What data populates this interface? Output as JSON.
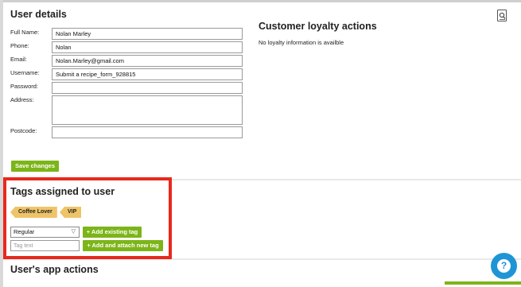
{
  "user_details": {
    "title": "User details",
    "fields": {
      "full_name": {
        "label": "Full Name:",
        "value": "Nolan Marley"
      },
      "phone": {
        "label": "Phone:",
        "value": "Nolan"
      },
      "email": {
        "label": "Email:",
        "value": "Nolan.Marley@gmail.com"
      },
      "username": {
        "label": "Username:",
        "value": "Submit a recipe_form_928815"
      },
      "password": {
        "label": "Password:",
        "value": ""
      },
      "address": {
        "label": "Address:",
        "value": ""
      },
      "postcode": {
        "label": "Postcode:",
        "value": ""
      }
    },
    "save_label": "Save changes"
  },
  "loyalty": {
    "title": "Customer loyalty actions",
    "message": "No loyalty information is availble"
  },
  "tags": {
    "title": "Tags assigned to user",
    "assigned": [
      "Coffee Lover",
      "VIP"
    ],
    "select_value": "Regular",
    "add_existing_label": "+ Add existing tag",
    "new_tag_placeholder": "Tag text",
    "add_new_label": "+ Add and attach new tag"
  },
  "app_actions": {
    "title": "User's app actions"
  },
  "icons": {
    "corner": "mobile-search-icon",
    "help": "question-icon",
    "select": "chevron-down-icon"
  },
  "colors": {
    "accent_green": "#7cb518",
    "tag_color": "#efc468",
    "highlight_red": "#e8291c",
    "help_blue": "#1f95d6"
  }
}
